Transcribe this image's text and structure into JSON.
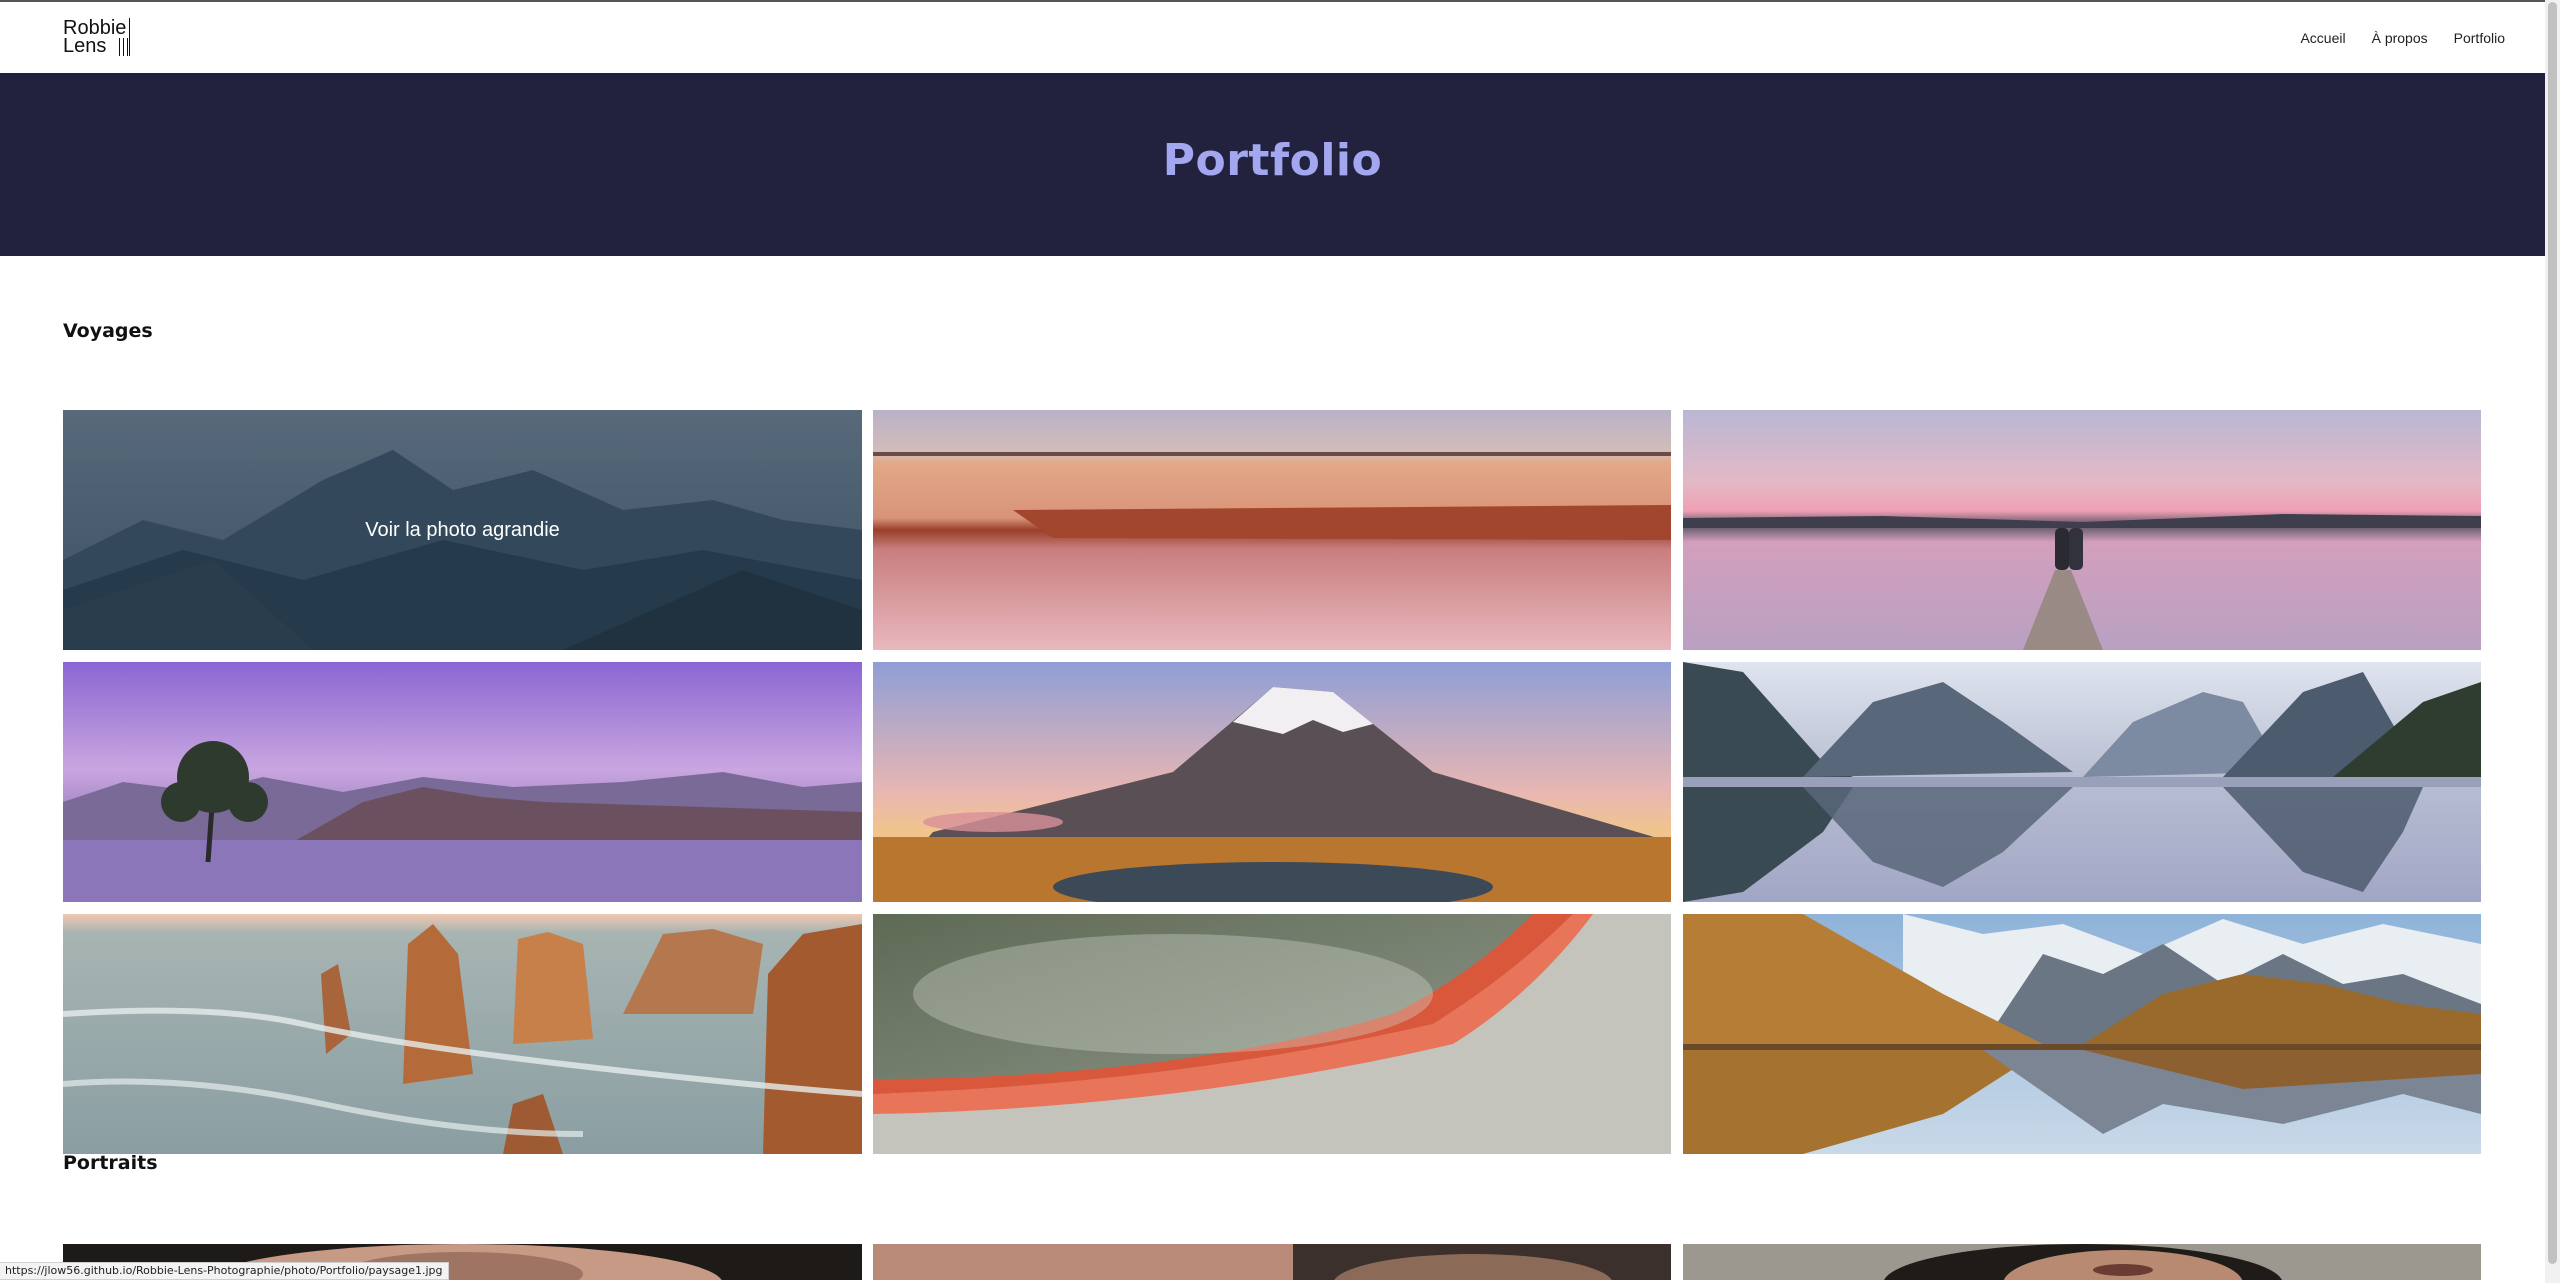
{
  "header": {
    "logo": {
      "line1": "Robbie",
      "line2": "Lens"
    },
    "nav": [
      {
        "label": "Accueil"
      },
      {
        "label": "À propos"
      },
      {
        "label": "Portfolio"
      }
    ]
  },
  "banner": {
    "title": "Portfolio"
  },
  "sections": {
    "voyages": {
      "title": "Voyages",
      "hover_label": "Voir la photo agrandie",
      "photos": [
        "mountain-range",
        "beach-reflection",
        "couple-on-pier",
        "lone-tree-lake",
        "snowy-volcano",
        "fjord-reflection",
        "sea-stacks",
        "thermal-pool",
        "alpine-tarn"
      ]
    },
    "portraits": {
      "title": "Portraits"
    }
  },
  "status_bar": {
    "url": "https://jlow56.github.io/Robbie-Lens-Photographie/photo/Portfolio/paysage1.jpg"
  }
}
